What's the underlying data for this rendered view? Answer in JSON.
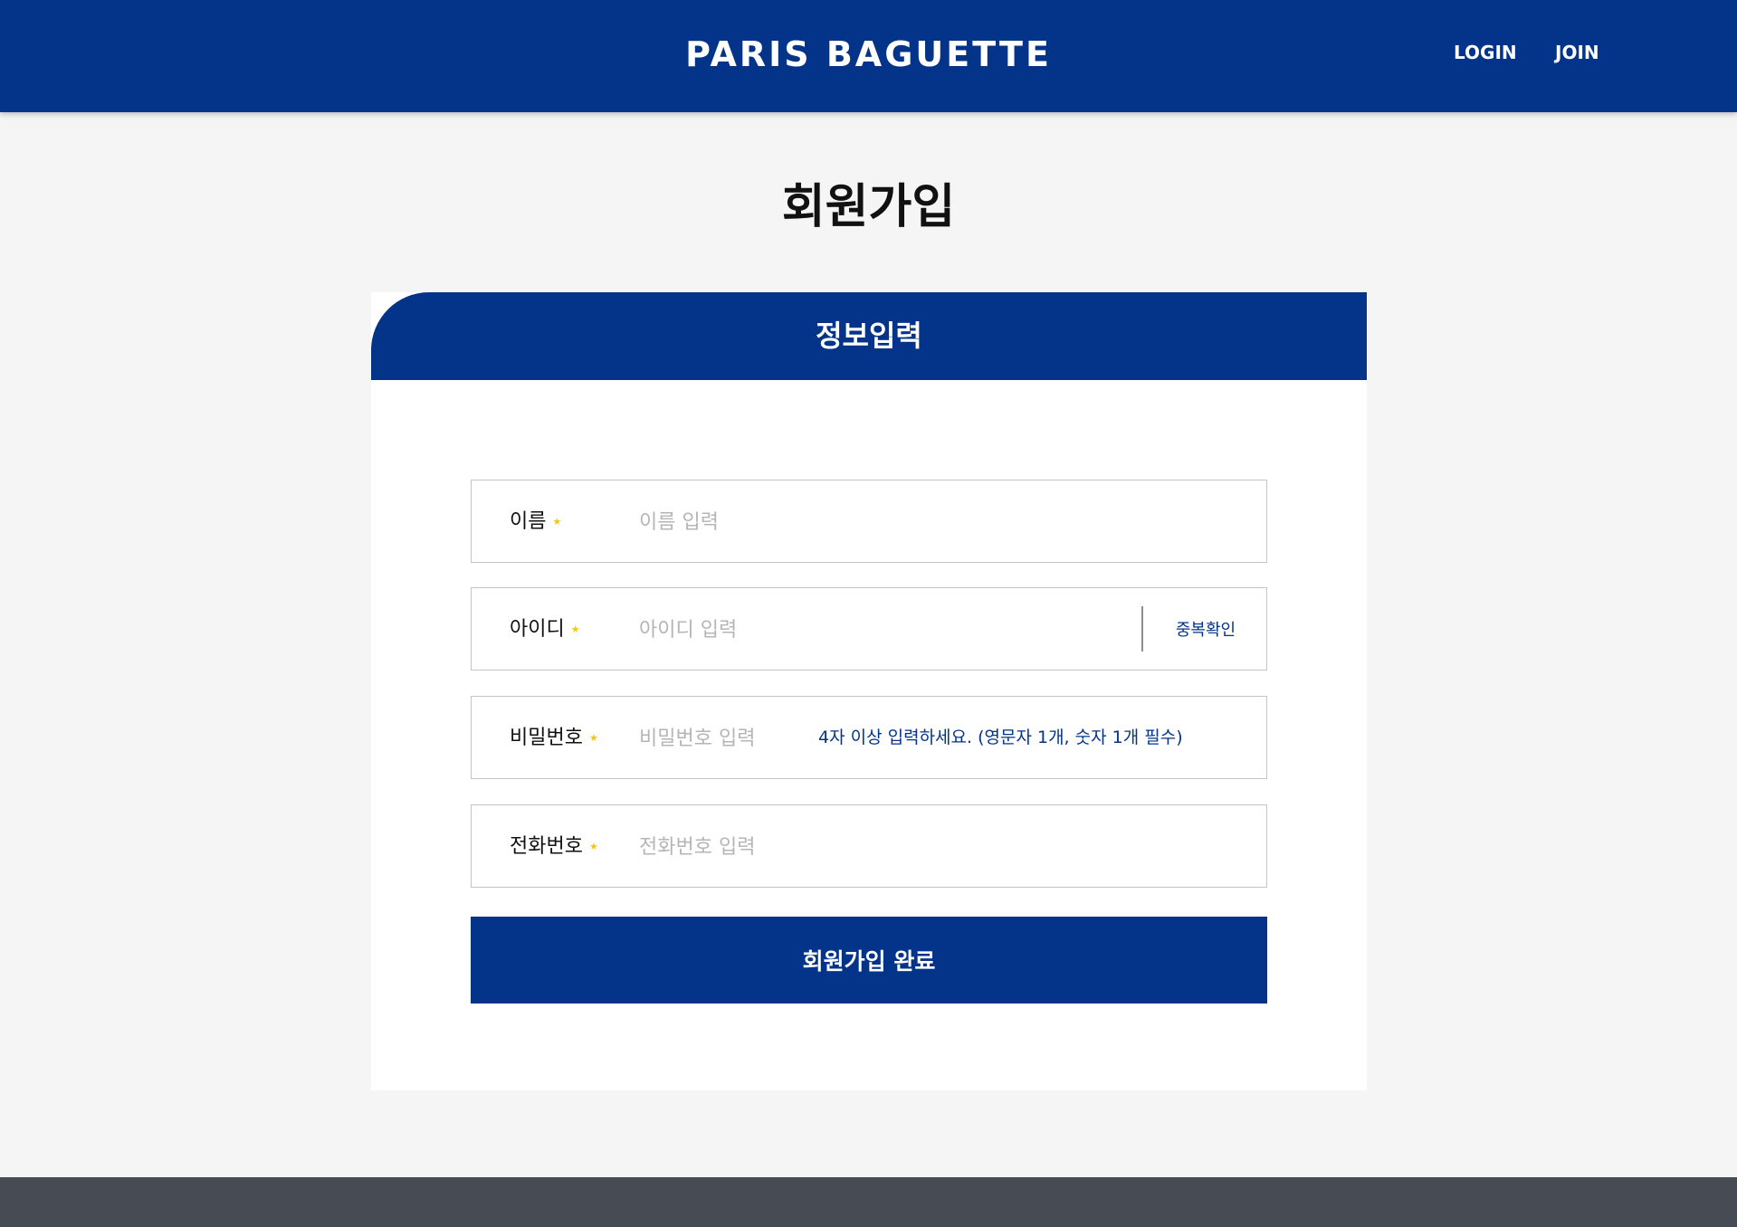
{
  "header": {
    "logo": "PARIS BAGUETTE",
    "nav": {
      "login": "LOGIN",
      "join": "JOIN"
    }
  },
  "page": {
    "title": "회원가입"
  },
  "form": {
    "section_title": "정보입력",
    "required_mark": "★",
    "fields": {
      "name": {
        "label": "이름",
        "placeholder": "이름 입력",
        "value": ""
      },
      "id": {
        "label": "아이디",
        "placeholder": "아이디 입력",
        "value": "",
        "check_button": "중복확인"
      },
      "password": {
        "label": "비밀번호",
        "placeholder": "비밀번호 입력",
        "value": "",
        "hint": "4자 이상 입력하세요. (영문자 1개, 숫자 1개 필수)"
      },
      "phone": {
        "label": "전화번호",
        "placeholder": "전화번호 입력",
        "value": ""
      }
    },
    "submit": "회원가입 완료"
  },
  "colors": {
    "brand": "#033489",
    "star": "#f5c518",
    "footer": "#474b54",
    "background": "#f5f5f5"
  }
}
